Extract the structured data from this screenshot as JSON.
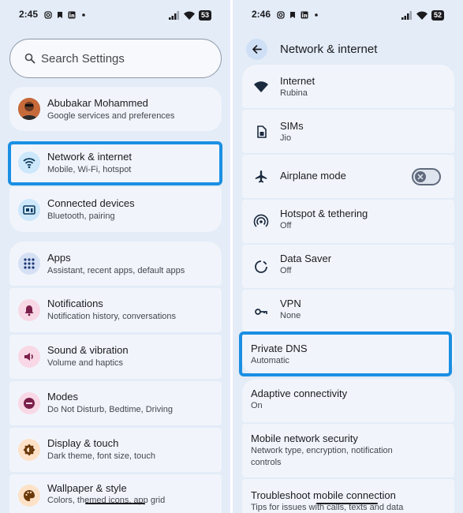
{
  "left": {
    "status": {
      "time": "2:45",
      "battery": "53"
    },
    "search": {
      "placeholder": "Search Settings"
    },
    "account": {
      "name": "Abubakar Mohammed",
      "subtitle": "Google services and preferences"
    },
    "items": [
      {
        "title": "Network & internet",
        "subtitle": "Mobile, Wi-Fi, hotspot",
        "icon": "wifi-icon",
        "icon_bg": "#cde7fb"
      },
      {
        "title": "Connected devices",
        "subtitle": "Bluetooth, pairing",
        "icon": "devices-icon",
        "icon_bg": "#cde7fb"
      },
      {
        "title": "Apps",
        "subtitle": "Assistant, recent apps, default apps",
        "icon": "apps-grid-icon",
        "icon_bg": "#d6e0f5"
      },
      {
        "title": "Notifications",
        "subtitle": "Notification history, conversations",
        "icon": "bell-icon",
        "icon_bg": "#f9d8e6"
      },
      {
        "title": "Sound & vibration",
        "subtitle": "Volume and haptics",
        "icon": "speaker-icon",
        "icon_bg": "#f9d8e6"
      },
      {
        "title": "Modes",
        "subtitle": "Do Not Disturb, Bedtime, Driving",
        "icon": "do-not-disturb-icon",
        "icon_bg": "#f9d8e6"
      },
      {
        "title": "Display & touch",
        "subtitle": "Dark theme, font size, touch",
        "icon": "brightness-icon",
        "icon_bg": "#fde2c8"
      },
      {
        "title": "Wallpaper & style",
        "subtitle": "Colors, themed icons, app grid",
        "icon": "palette-icon",
        "icon_bg": "#fde2c8"
      }
    ]
  },
  "right": {
    "status": {
      "time": "2:46",
      "battery": "52"
    },
    "header": {
      "title": "Network & internet"
    },
    "items": [
      {
        "title": "Internet",
        "subtitle": "Rubina",
        "icon": "wifi-icon"
      },
      {
        "title": "SIMs",
        "subtitle": "Jio",
        "icon": "sim-card-icon"
      },
      {
        "title": "Airplane mode",
        "subtitle": "",
        "icon": "airplane-icon",
        "toggle": false
      },
      {
        "title": "Hotspot & tethering",
        "subtitle": "Off",
        "icon": "hotspot-icon"
      },
      {
        "title": "Data Saver",
        "subtitle": "Off",
        "icon": "data-saver-icon"
      },
      {
        "title": "VPN",
        "subtitle": "None",
        "icon": "vpn-key-icon"
      },
      {
        "title": "Private DNS",
        "subtitle": "Automatic"
      },
      {
        "title": "Adaptive connectivity",
        "subtitle": "On"
      },
      {
        "title": "Mobile network security",
        "subtitle1": "Network type, encryption, notification",
        "subtitle2": "controls"
      },
      {
        "title": "Troubleshoot mobile connection",
        "subtitle": "Tips for issues with calls, texts and data"
      }
    ]
  },
  "colors": {
    "highlight": "#1a8fe3",
    "background": "#e3ecf7",
    "card": "#f1f5fb"
  }
}
